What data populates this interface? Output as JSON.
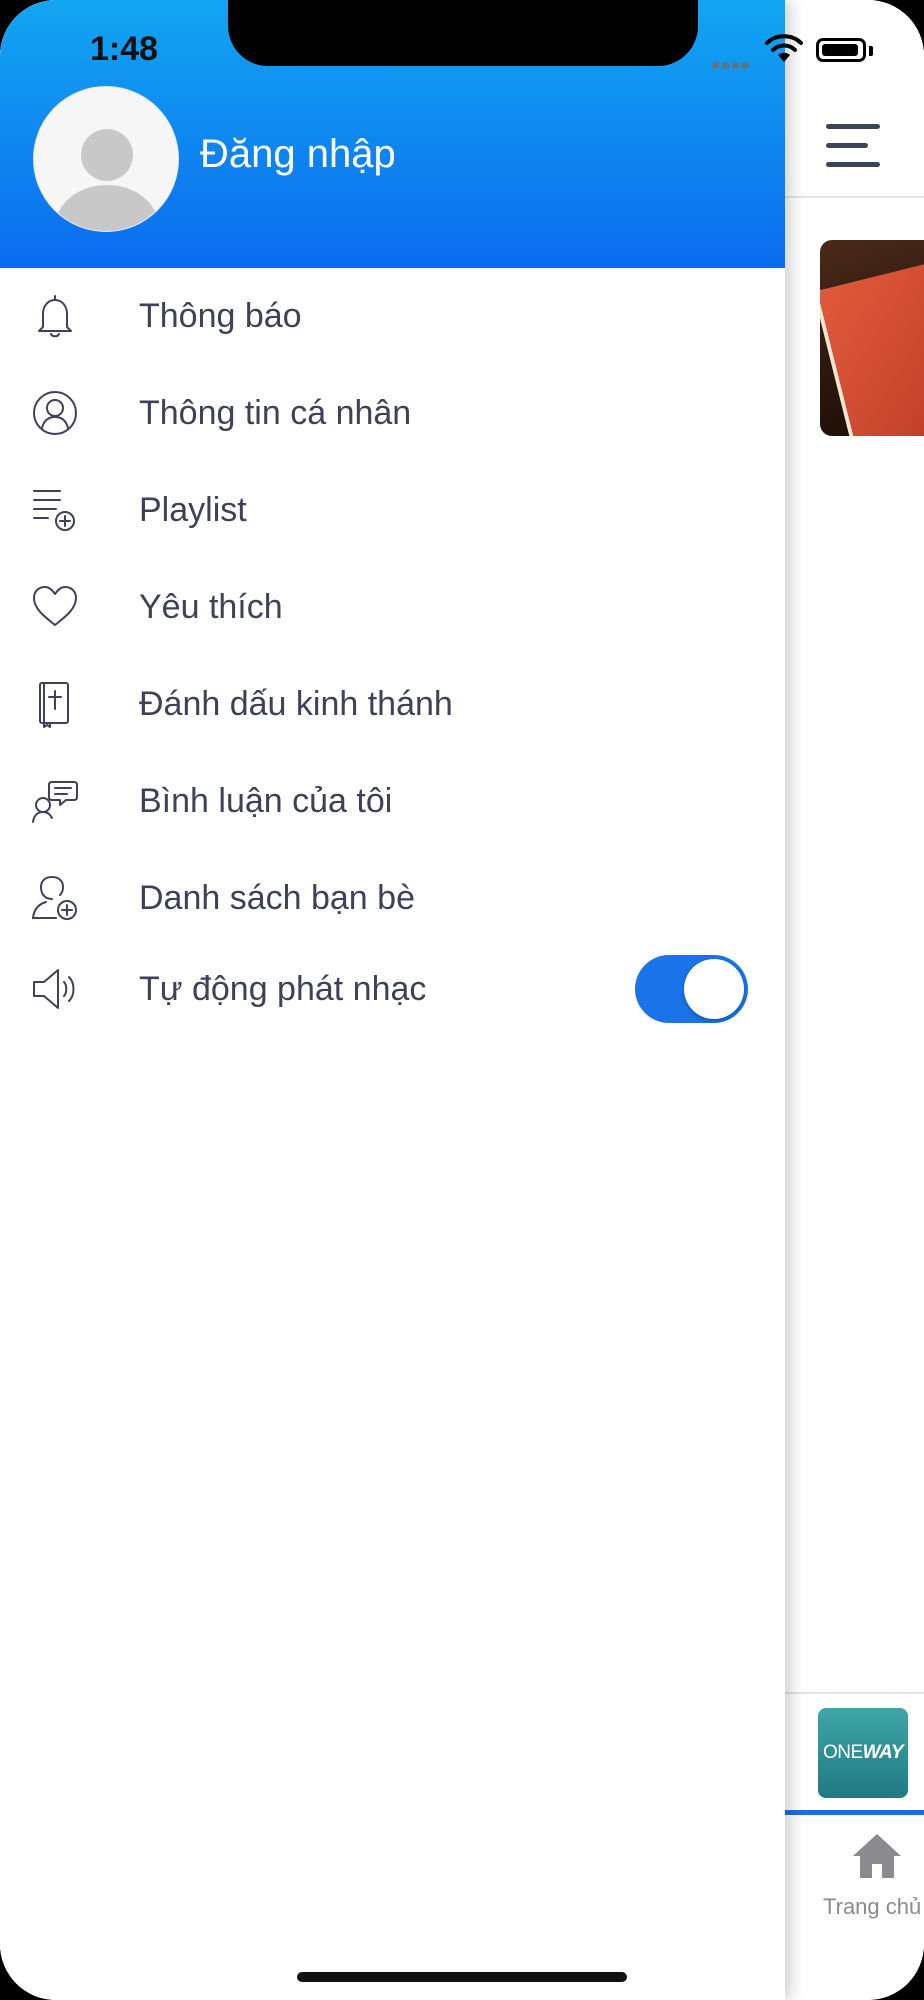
{
  "status_bar": {
    "time": "1:48"
  },
  "drawer": {
    "login_label": "Đăng nhập",
    "menu": [
      {
        "label": "Thông báo",
        "icon": "bell-icon"
      },
      {
        "label": "Thông tin cá nhân",
        "icon": "profile-icon"
      },
      {
        "label": "Playlist",
        "icon": "playlist-add-icon"
      },
      {
        "label": "Yêu thích",
        "icon": "heart-icon"
      },
      {
        "label": "Đánh dấu kinh thánh",
        "icon": "bible-bookmark-icon"
      },
      {
        "label": "Bình luận của tôi",
        "icon": "comment-icon"
      },
      {
        "label": "Danh sách bạn bè",
        "icon": "add-friend-icon"
      },
      {
        "label": "Tự động phát nhạc",
        "icon": "speaker-icon",
        "toggle_on": true
      }
    ]
  },
  "background_app": {
    "mini_player_logo": {
      "prefix": "ONE",
      "suffix": "WAY"
    },
    "home_tab_label": "Trang chủ"
  },
  "colors": {
    "header_gradient_top": "#12a6f1",
    "header_gradient_bottom": "#0b6cf0",
    "accent": "#1a73e8",
    "text": "#3d4258"
  }
}
